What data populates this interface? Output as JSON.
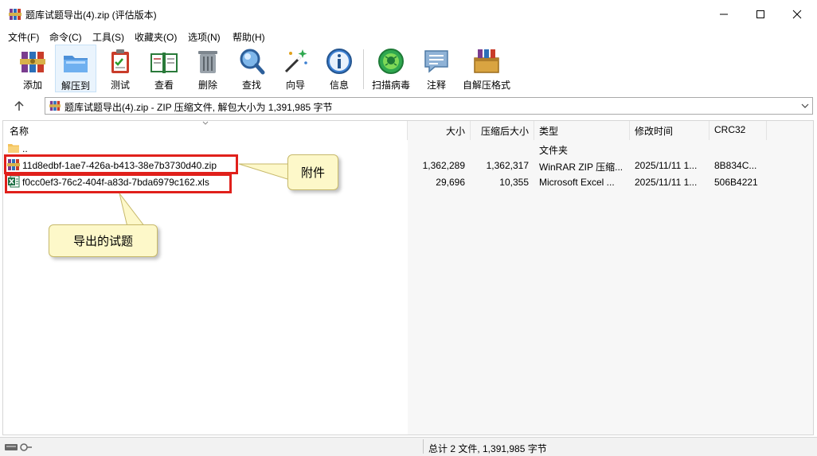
{
  "window": {
    "title": "题库试题导出(4).zip (评估版本)",
    "controls": [
      "minimize",
      "maximize",
      "close"
    ]
  },
  "menu": [
    "文件(F)",
    "命令(C)",
    "工具(S)",
    "收藏夹(O)",
    "选项(N)",
    "帮助(H)"
  ],
  "toolbar": [
    {
      "label": "添加",
      "icon": "add-archive-icon"
    },
    {
      "label": "解压到",
      "icon": "extract-to-icon",
      "active": true
    },
    {
      "label": "测试",
      "icon": "test-icon"
    },
    {
      "label": "查看",
      "icon": "view-icon"
    },
    {
      "label": "删除",
      "icon": "delete-icon"
    },
    {
      "label": "查找",
      "icon": "find-icon"
    },
    {
      "label": "向导",
      "icon": "wizard-icon"
    },
    {
      "label": "信息",
      "icon": "info-icon"
    },
    {
      "label": "扫描病毒",
      "icon": "virus-scan-icon"
    },
    {
      "label": "注释",
      "icon": "comment-icon"
    },
    {
      "label": "自解压格式",
      "icon": "sfx-icon"
    }
  ],
  "address": {
    "text": "题库试题导出(4).zip - ZIP 压缩文件, 解包大小为 1,391,985 字节"
  },
  "columns": {
    "name": "名称",
    "size": "大小",
    "packed": "压缩后大小",
    "type": "类型",
    "modified": "修改时间",
    "crc": "CRC32"
  },
  "files": [
    {
      "name": "..",
      "size": "",
      "packed": "",
      "type": "文件夹",
      "modified": "",
      "crc": "",
      "icon": "folder-icon"
    },
    {
      "name": "11d8edbf-1ae7-426a-b413-38e7b3730d40.zip",
      "size": "1,362,289",
      "packed": "1,362,317",
      "type": "WinRAR ZIP 压缩...",
      "modified": "2025/11/11 1...",
      "crc": "8B834C...",
      "icon": "zip-archive-icon"
    },
    {
      "name": "f0cc0ef3-76c2-404f-a83d-7bda6979c162.xls",
      "size": "29,696",
      "packed": "10,355",
      "type": "Microsoft Excel ...",
      "modified": "2025/11/11 1...",
      "crc": "506B4221",
      "icon": "excel-file-icon"
    }
  ],
  "annotations": {
    "attachment": "附件",
    "exported": "导出的试题"
  },
  "status": {
    "text": "总计 2 文件, 1,391,985 字节"
  },
  "colors": {
    "highlight": "#e0201b",
    "callout_bg": "#fdf8c9",
    "active_tool": "#eaf4fd"
  }
}
